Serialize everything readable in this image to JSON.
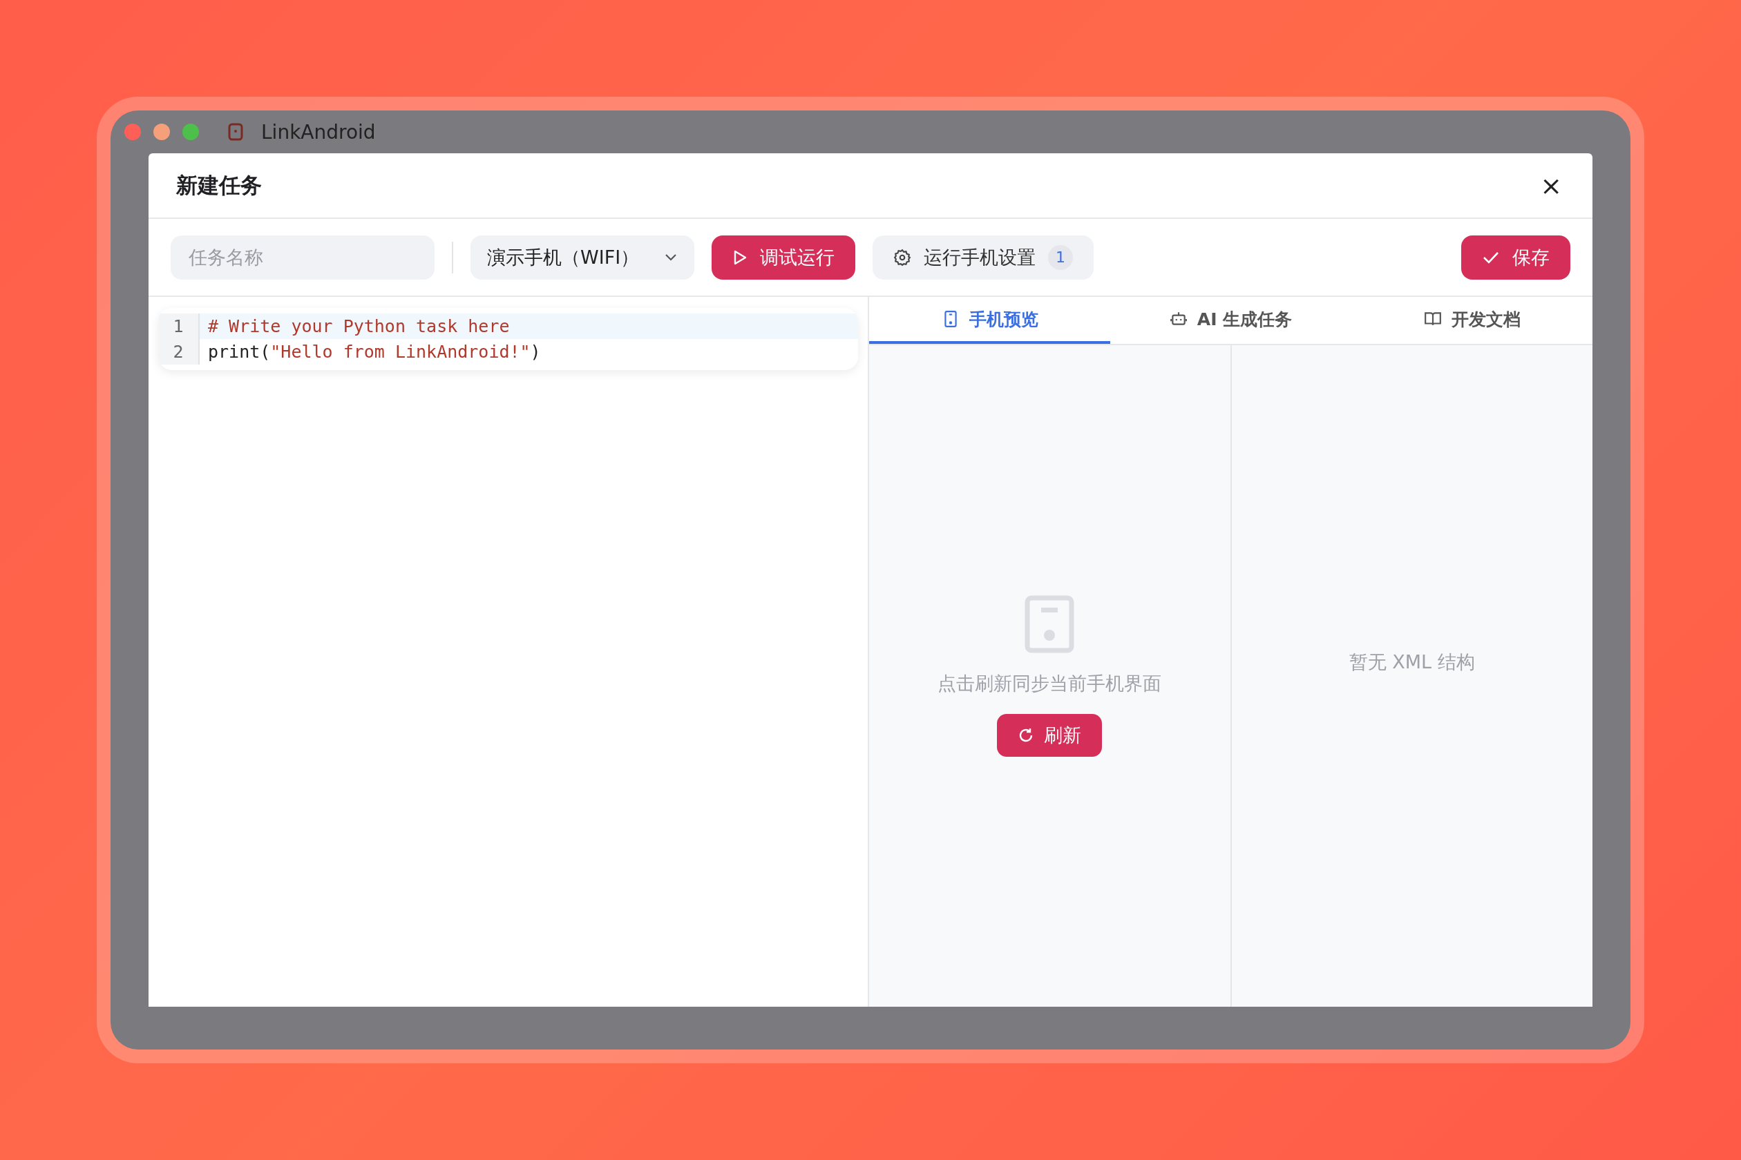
{
  "window": {
    "title": "LinkAndroid"
  },
  "dialog": {
    "title": "新建任务",
    "close": "×"
  },
  "toolbar": {
    "task_name": {
      "placeholder": "任务名称"
    },
    "device_select": {
      "value": "演示手机（WIFI）"
    },
    "debug_button": "调试运行",
    "settings_button": {
      "label": "运行手机设置",
      "badge": "1"
    },
    "save_button": "保存"
  },
  "editor": {
    "lines": [
      {
        "number": "1",
        "highlighted": true,
        "tokens": [
          {
            "kind": "comment",
            "text": "# Write your Python task here"
          }
        ]
      },
      {
        "number": "2",
        "highlighted": false,
        "tokens": [
          {
            "kind": "plain",
            "text": "print("
          },
          {
            "kind": "string",
            "text": "\"Hello from LinkAndroid!\""
          },
          {
            "kind": "plain",
            "text": ")"
          }
        ]
      }
    ]
  },
  "tabs": [
    {
      "kind": "phone",
      "label": "手机预览",
      "selected": true
    },
    {
      "kind": "robot",
      "label": "AI 生成任务",
      "selected": false
    },
    {
      "kind": "book",
      "label": "开发文档",
      "selected": false
    }
  ],
  "preview": {
    "message": "点击刷新同步当前手机界面",
    "refresh_button": "刷新",
    "xml_empty": "暂无 XML 结构"
  }
}
